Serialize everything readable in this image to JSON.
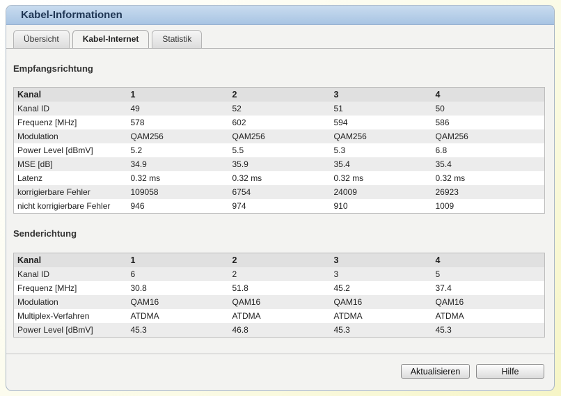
{
  "window": {
    "title": "Kabel-Informationen"
  },
  "tabs": [
    {
      "label": "Übersicht"
    },
    {
      "label": "Kabel-Internet"
    },
    {
      "label": "Statistik"
    }
  ],
  "downstream": {
    "title": "Empfangsrichtung",
    "header": [
      "Kanal",
      "1",
      "2",
      "3",
      "4"
    ],
    "rows": [
      [
        "Kanal ID",
        "49",
        "52",
        "51",
        "50"
      ],
      [
        "Frequenz [MHz]",
        "578",
        "602",
        "594",
        "586"
      ],
      [
        "Modulation",
        "QAM256",
        "QAM256",
        "QAM256",
        "QAM256"
      ],
      [
        "Power Level [dBmV]",
        "5.2",
        "5.5",
        "5.3",
        "6.8"
      ],
      [
        "MSE [dB]",
        "34.9",
        "35.9",
        "35.4",
        "35.4"
      ],
      [
        "Latenz",
        "0.32 ms",
        "0.32 ms",
        "0.32 ms",
        "0.32 ms"
      ],
      [
        "korrigierbare Fehler",
        "109058",
        "6754",
        "24009",
        "26923"
      ],
      [
        "nicht korrigierbare Fehler",
        "946",
        "974",
        "910",
        "1009"
      ]
    ]
  },
  "upstream": {
    "title": "Senderichtung",
    "header": [
      "Kanal",
      "1",
      "2",
      "3",
      "4"
    ],
    "rows": [
      [
        "Kanal ID",
        "6",
        "2",
        "3",
        "5"
      ],
      [
        "Frequenz [MHz]",
        "30.8",
        "51.8",
        "45.2",
        "37.4"
      ],
      [
        "Modulation",
        "QAM16",
        "QAM16",
        "QAM16",
        "QAM16"
      ],
      [
        "Multiplex-Verfahren",
        "ATDMA",
        "ATDMA",
        "ATDMA",
        "ATDMA"
      ],
      [
        "Power Level [dBmV]",
        "45.3",
        "46.8",
        "45.3",
        "45.3"
      ]
    ]
  },
  "buttons": {
    "refresh": "Aktualisieren",
    "help": "Hilfe"
  }
}
